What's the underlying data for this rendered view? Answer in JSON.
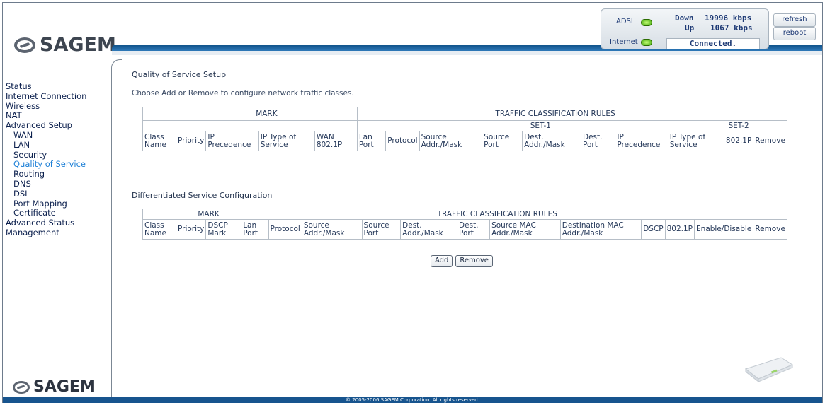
{
  "brand": {
    "logo_text": "SAGEM",
    "footer_logo_text": "SAGEM"
  },
  "status_panel": {
    "adsl_label": "ADSL",
    "internet_label": "Internet",
    "down_label": "Down",
    "down_value": "19996 kbps",
    "up_label": "Up",
    "up_value": "1067 kbps",
    "connection_status": "Connected.",
    "refresh_label": "refresh",
    "reboot_label": "reboot",
    "led_color": "#37a000"
  },
  "sidebar": {
    "items": [
      {
        "label": "Status",
        "sub": false,
        "active": false
      },
      {
        "label": "Internet Connection",
        "sub": false,
        "active": false
      },
      {
        "label": "Wireless",
        "sub": false,
        "active": false
      },
      {
        "label": "NAT",
        "sub": false,
        "active": false
      },
      {
        "label": "Advanced Setup",
        "sub": false,
        "active": false
      },
      {
        "label": "WAN",
        "sub": true,
        "active": false
      },
      {
        "label": "LAN",
        "sub": true,
        "active": false
      },
      {
        "label": "Security",
        "sub": true,
        "active": false
      },
      {
        "label": "Quality of Service",
        "sub": true,
        "active": true
      },
      {
        "label": "Routing",
        "sub": true,
        "active": false
      },
      {
        "label": "DNS",
        "sub": true,
        "active": false
      },
      {
        "label": "DSL",
        "sub": true,
        "active": false
      },
      {
        "label": "Port Mapping",
        "sub": true,
        "active": false
      },
      {
        "label": "Certificate",
        "sub": true,
        "active": false
      },
      {
        "label": "Advanced Status",
        "sub": false,
        "active": false
      },
      {
        "label": "Management",
        "sub": false,
        "active": false
      }
    ]
  },
  "qos": {
    "title": "Quality of Service Setup",
    "description": "Choose Add or Remove to configure network traffic classes.",
    "group_mark": "MARK",
    "group_rules": "TRAFFIC CLASSIFICATION RULES",
    "set1": "SET-1",
    "set2": "SET-2",
    "columns": [
      "Class Name",
      "Priority",
      "IP Precedence",
      "IP Type of Service",
      "WAN 802.1P",
      "Lan Port",
      "Protocol",
      "Source Addr./Mask",
      "Source Port",
      "Dest. Addr./Mask",
      "Dest. Port",
      "IP Precedence",
      "IP Type of Service",
      "802.1P",
      "Remove"
    ]
  },
  "diffserv": {
    "title": "Differentiated Service Configuration",
    "group_mark": "MARK",
    "group_rules": "TRAFFIC CLASSIFICATION RULES",
    "columns": [
      "Class Name",
      "Priority",
      "DSCP Mark",
      "Lan Port",
      "Protocol",
      "Source Addr./Mask",
      "Source Port",
      "Dest. Addr./Mask",
      "Dest. Port",
      "Source MAC Addr./Mask",
      "Destination MAC Addr./Mask",
      "DSCP",
      "802.1P",
      "Enable/Disable",
      "Remove"
    ]
  },
  "actions": {
    "add_label": "Add",
    "remove_label": "Remove"
  },
  "footer": {
    "copyright": "© 2005-2006 SAGEM Corporation. All rights reserved."
  }
}
